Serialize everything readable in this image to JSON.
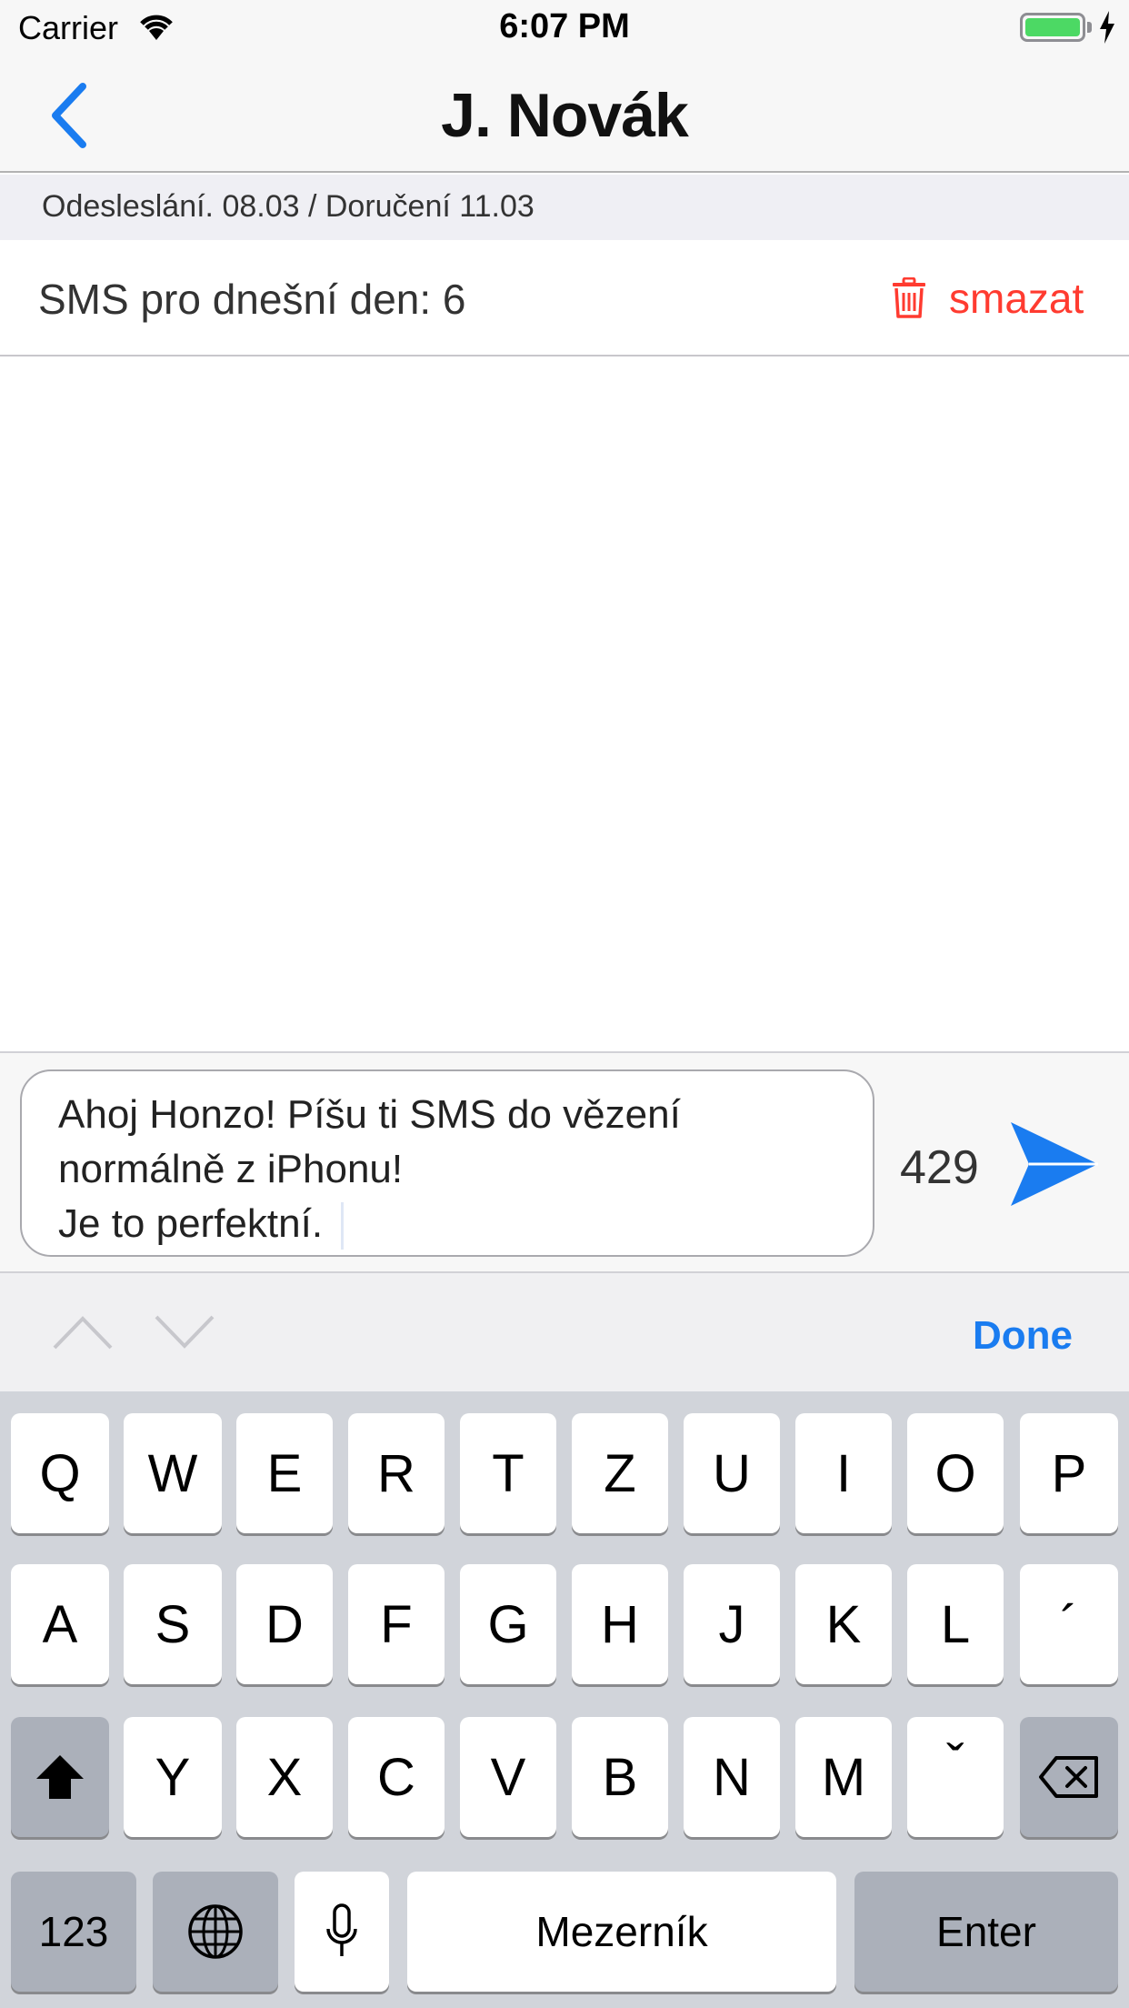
{
  "status_bar": {
    "carrier": "Carrier",
    "time": "6:07 PM",
    "battery_level": 1.0
  },
  "nav": {
    "title": "J. Novák",
    "back_icon": "chevron-left-icon"
  },
  "info": {
    "text": "Odesleslání. 08.03 /  Doručení 11.03"
  },
  "sms_count": {
    "label": "SMS pro dnešní den: 6",
    "delete_label": "smazat",
    "delete_icon": "trash-icon",
    "delete_color": "#ff3b30"
  },
  "composer": {
    "message": "Ahoj Honzo! Píšu ti SMS do vězení\nnormálně z iPhonu!\nJe to perfektní.",
    "char_count": "429",
    "send_icon": "send-icon",
    "accent": "#1a7cf0"
  },
  "accessory": {
    "done_label": "Done"
  },
  "keyboard": {
    "row1": [
      "Q",
      "W",
      "E",
      "R",
      "T",
      "Z",
      "U",
      "I",
      "O",
      "P"
    ],
    "row2": [
      "A",
      "S",
      "D",
      "F",
      "G",
      "H",
      "J",
      "K",
      "L",
      "´"
    ],
    "row3": [
      "Y",
      "X",
      "C",
      "V",
      "B",
      "N",
      "M",
      "ˇ"
    ],
    "numbers_label": "123",
    "space_label": "Mezerník",
    "enter_label": "Enter"
  }
}
